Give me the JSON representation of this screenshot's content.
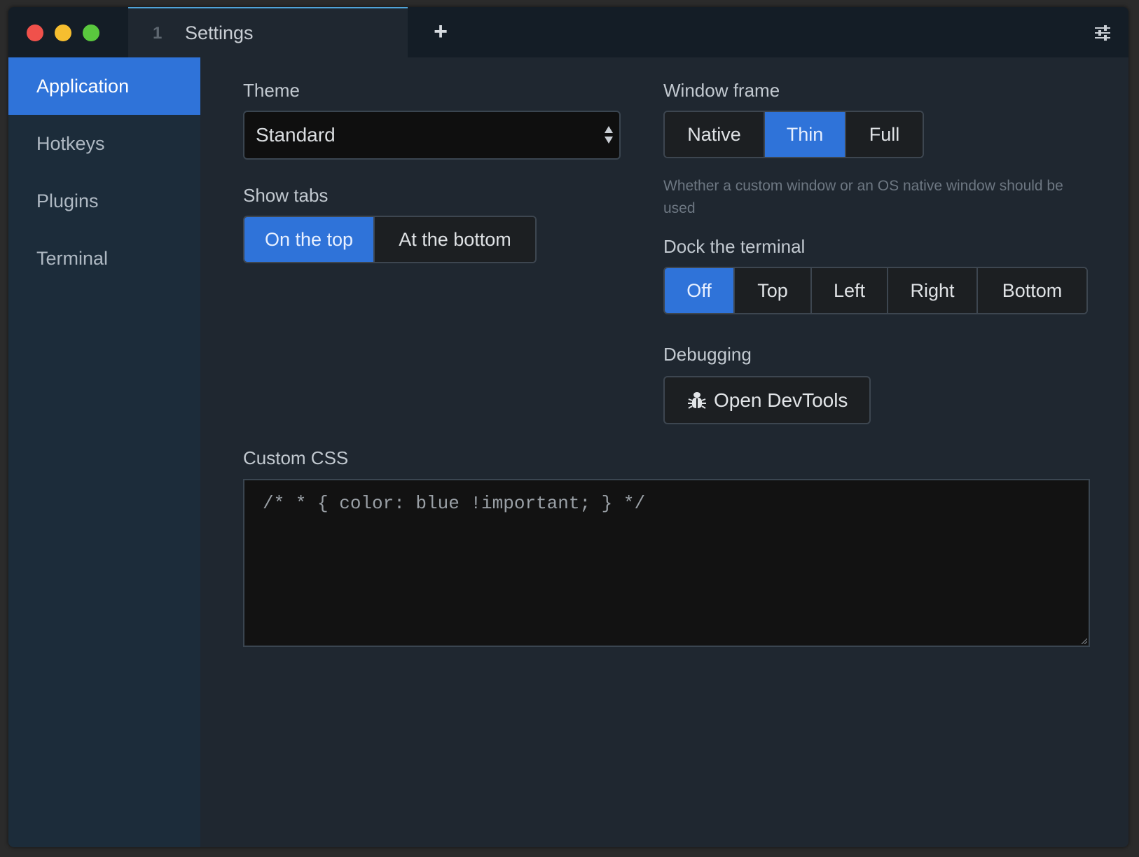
{
  "titlebar": {
    "tab_number": "1",
    "tab_title": "Settings",
    "new_tab_glyph": "+"
  },
  "sidebar": {
    "items": [
      {
        "label": "Application",
        "active": true
      },
      {
        "label": "Hotkeys",
        "active": false
      },
      {
        "label": "Plugins",
        "active": false
      },
      {
        "label": "Terminal",
        "active": false
      }
    ]
  },
  "theme": {
    "label": "Theme",
    "value": "Standard"
  },
  "show_tabs": {
    "label": "Show tabs",
    "options": [
      "On the top",
      "At the bottom"
    ],
    "selected": "On the top"
  },
  "window_frame": {
    "label": "Window frame",
    "options": [
      "Native",
      "Thin",
      "Full"
    ],
    "selected": "Thin",
    "help": "Whether a custom window or an OS native window should be used"
  },
  "dock_terminal": {
    "label": "Dock the terminal",
    "options": [
      "Off",
      "Top",
      "Left",
      "Right",
      "Bottom"
    ],
    "selected": "Off"
  },
  "debugging": {
    "label": "Debugging",
    "button_label": "Open DevTools",
    "icon": "bug-icon"
  },
  "custom_css": {
    "label": "Custom CSS",
    "placeholder": "/* * { color: blue !important; } */"
  },
  "colors": {
    "accent": "#2f73d9",
    "sidebar_bg": "#1c2c3a",
    "content_bg": "#1f2730",
    "titlebar_bg": "#141d26"
  }
}
